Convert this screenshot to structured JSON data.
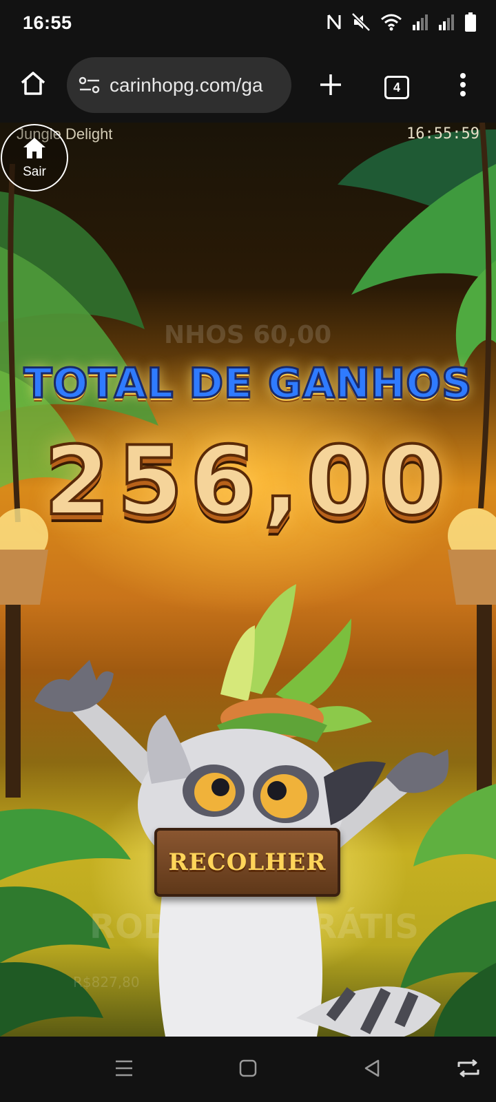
{
  "status_bar": {
    "time": "16:55",
    "icons": [
      "nfc-icon",
      "mute-icon",
      "wifi-icon",
      "signal-icon",
      "signal-icon-2",
      "battery-icon"
    ]
  },
  "browser": {
    "url": "carinhopg.com/ga",
    "tab_count": "4",
    "icons": [
      "home-icon",
      "site-settings-icon",
      "new-tab-icon",
      "tab-switcher-icon",
      "more-menu-icon"
    ]
  },
  "game": {
    "title": "Jungle Delight",
    "clock": "16:55:59",
    "exit_label": "Sair",
    "total_title": "TOTAL DE GANHOS",
    "total_amount": "256,00",
    "collect_label": "RECOLHER",
    "bg_watermark_1": "NHOS 60,00",
    "bg_watermark_2": "RODADAS GRÁTIS",
    "bg_watermark_3": "R$827,80"
  },
  "nav_bar": {
    "icons": [
      "recents-icon",
      "home-nav-icon",
      "back-icon",
      "rotate-icon"
    ]
  },
  "colors": {
    "bar_bg": "#121212",
    "url_pill": "#2f2f2f",
    "title_blue": "#2f7bff",
    "amount_gold": "#f5d49a",
    "button_wood": "#6e4220",
    "button_text": "#ffd55a"
  }
}
